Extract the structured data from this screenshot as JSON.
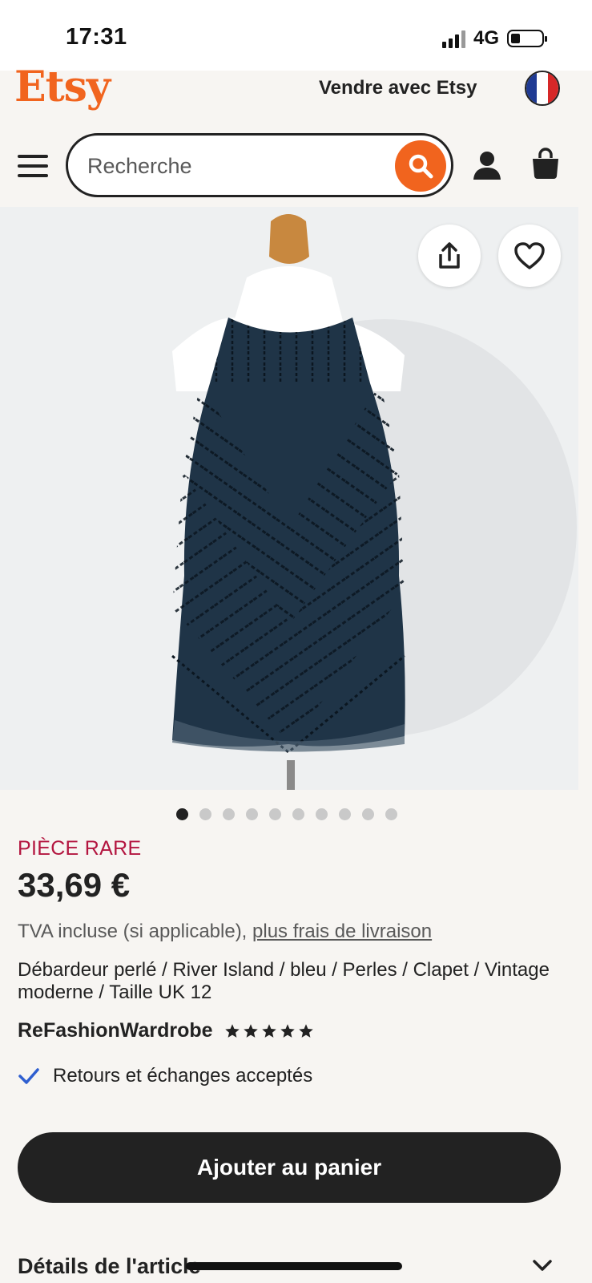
{
  "status_bar": {
    "time": "17:31",
    "network": "4G",
    "battery_level": 0.3
  },
  "header": {
    "logo": "Etsy",
    "sell_link": "Vendre avec Etsy",
    "search_placeholder": "Recherche"
  },
  "product": {
    "image_count": 10,
    "active_image_index": 0,
    "badge": "PIÈCE RARE",
    "price": "33,69 €",
    "vat_text": "TVA incluse (si applicable), ",
    "shipping_link": "plus frais de livraison",
    "title": "Débardeur perlé / River Island / bleu / Perles / Clapet / Vintage moderne / Taille UK 12",
    "shop_name": "ReFashionWardrobe",
    "rating": 5,
    "returns": "Retours et échanges acceptés",
    "add_to_cart": "Ajouter au panier",
    "details_title": "Détails de l'article"
  },
  "colors": {
    "brand": "#f1641e",
    "rare_badge": "#b3153f",
    "check": "#2f5fd0",
    "dark": "#222222",
    "garment": "#1f3447"
  }
}
